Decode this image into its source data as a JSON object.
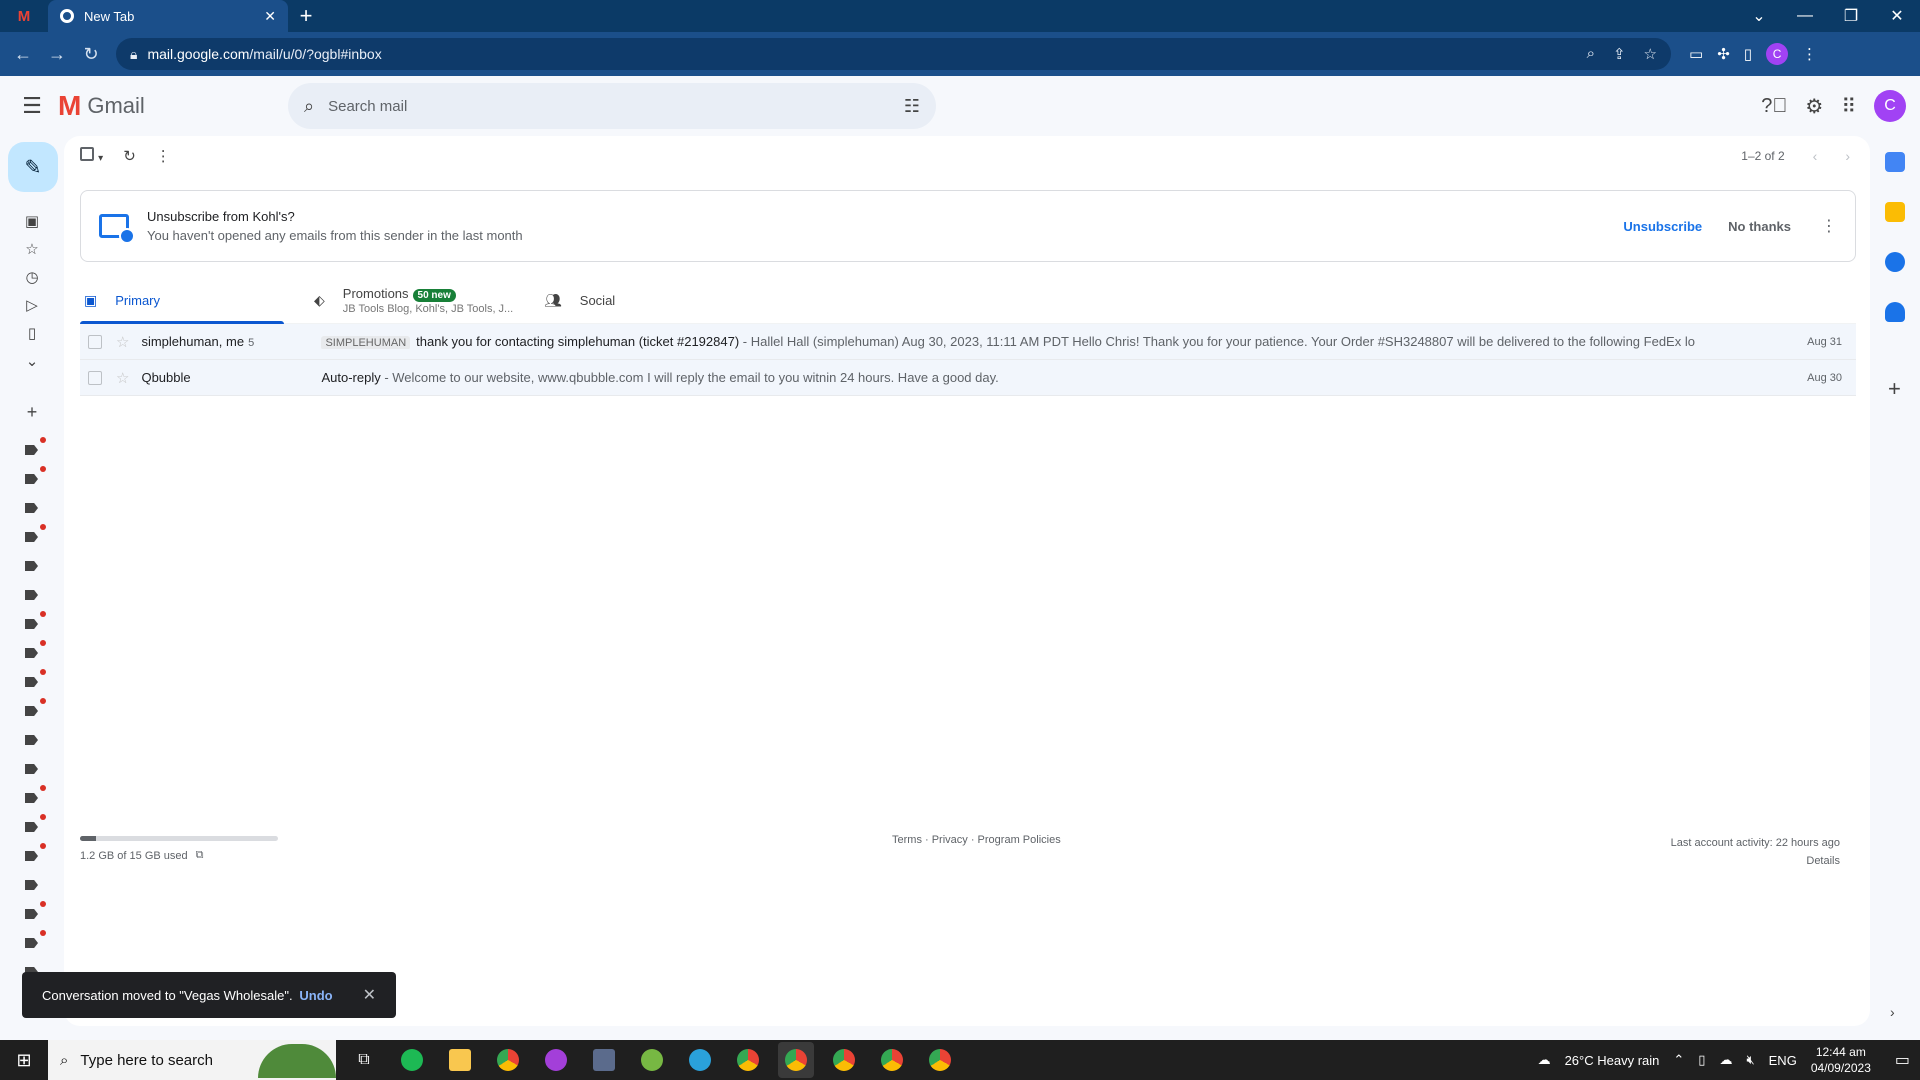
{
  "browser": {
    "tab_title": "New Tab",
    "url_host": "mail.google.com",
    "url_path": "/mail/u/0/?ogbl#inbox",
    "profile_letter": "C"
  },
  "gmail": {
    "logo_text": "Gmail",
    "search_placeholder": "Search mail",
    "avatar_letter": "C",
    "pager": "1–2 of 2",
    "unsubscribe": {
      "title": "Unsubscribe from Kohl's?",
      "subtitle": "You haven't opened any emails from this sender in the last month",
      "primary_action": "Unsubscribe",
      "secondary_action": "No thanks"
    },
    "tabs": [
      {
        "label": "Primary"
      },
      {
        "label": "Promotions",
        "badge": "50 new",
        "sub": "JB Tools Blog, Kohl's, JB Tools, J..."
      },
      {
        "label": "Social"
      }
    ],
    "emails": [
      {
        "sender": "simplehuman, me",
        "count": "5",
        "tag": "SIMPLEHUMAN",
        "subject": "thank you for contacting simplehuman (ticket #2192847)",
        "snippet": " - Hallel Hall (simplehuman) Aug 30, 2023, 11:11 AM PDT Hello Chris! Thank you for your patience. Your Order #SH3248807 will be delivered to the following FedEx lo",
        "date": "Aug 31"
      },
      {
        "sender": "Qbubble",
        "count": "",
        "tag": "",
        "subject": "Auto-reply",
        "snippet": " - Welcome to our website, www.qbubble.com I will reply the email to you witnin 24 hours. Have a good day.",
        "date": "Aug 30"
      }
    ],
    "footer": {
      "storage_used_fraction": 0.08,
      "storage": "1.2 GB of 15 GB used",
      "links": "Terms · Privacy · Program Policies",
      "activity": "Last account activity: 22 hours ago",
      "details": "Details"
    },
    "snackbar": {
      "message": "Conversation moved to \"Vegas Wholesale\".",
      "action": "Undo"
    }
  },
  "taskbar": {
    "search_placeholder": "Type here to search",
    "weather": "26°C  Heavy rain",
    "lang": "ENG",
    "time": "12:44 am",
    "date": "04/09/2023"
  },
  "colors": {
    "accent": "#0b57d0",
    "compose": "#c2e7ff",
    "badge": "#188038",
    "chrome": "#1b4f8a"
  }
}
